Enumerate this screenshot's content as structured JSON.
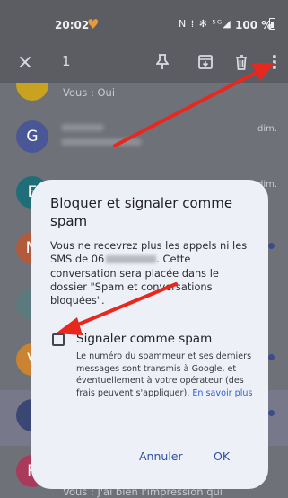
{
  "status_bar": {
    "time": "20:02",
    "signal_icons": "N ⁞ ✻ ⁵ᴳ◢",
    "battery": "100 %"
  },
  "top_bar": {
    "selected_count": "1",
    "close_icon": "×",
    "more_icon": "⋮"
  },
  "conversations": [
    {
      "avatar_letter": "",
      "avatar_color": "#c9a21f",
      "snippet": "Vous : Oui",
      "date": ""
    },
    {
      "avatar_letter": "G",
      "avatar_color": "#4a5797",
      "snippet": "",
      "date": "dim."
    },
    {
      "avatar_letter": "E",
      "avatar_color": "#1f6d78",
      "snippet": "",
      "date": "dim."
    },
    {
      "avatar_letter": "M",
      "avatar_color": "#b25a3c",
      "snippet": "",
      "date": ""
    },
    {
      "avatar_letter": "",
      "avatar_color": "#5c7a7d",
      "snippet": "",
      "date": ""
    },
    {
      "avatar_letter": "V",
      "avatar_color": "#c98331",
      "snippet": "",
      "date": ""
    },
    {
      "avatar_letter": "",
      "avatar_color": "#3a4673",
      "snippet": "",
      "date": ""
    },
    {
      "avatar_letter": "R",
      "avatar_color": "#a93a5c",
      "snippet": "Vous : J'ai bien l'impression qui",
      "date": ""
    }
  ],
  "dialog": {
    "title": "Bloquer et signaler comme spam",
    "body_part1": "Vous ne recevrez plus les appels ni les SMS de 06",
    "body_part2": ". Cette conversation sera placée dans le dossier \"Spam et conversations bloquées\".",
    "checkbox_label": "Signaler comme spam",
    "checkbox_desc": "Le numéro du spammeur et ses derniers messages sont transmis à Google, et éventuellement à votre opérateur (des frais peuvent s'appliquer).",
    "learn_more": "En savoir plus",
    "cancel": "Annuler",
    "ok": "OK"
  },
  "colors": {
    "accent": "#2f4fa8",
    "arrow": "#e8271f"
  }
}
